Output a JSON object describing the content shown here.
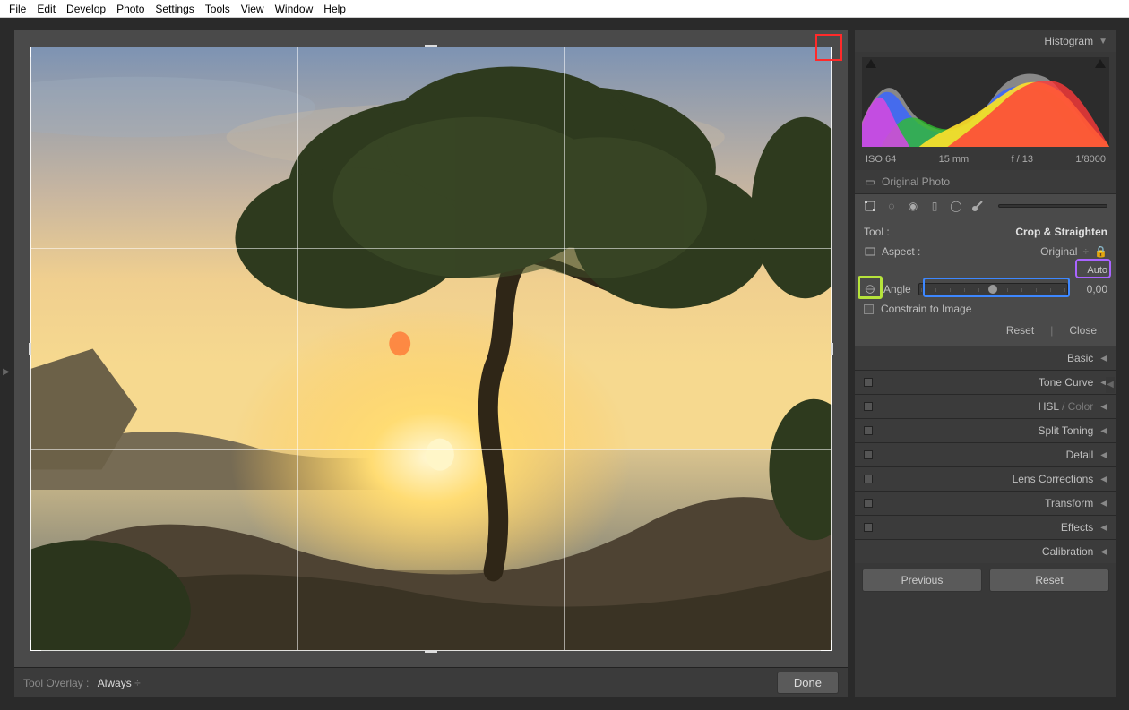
{
  "menu": [
    "File",
    "Edit",
    "Develop",
    "Photo",
    "Settings",
    "Tools",
    "View",
    "Window",
    "Help"
  ],
  "histogram_label": "Histogram",
  "meta": {
    "iso": "ISO 64",
    "focal": "15 mm",
    "aperture": "f / 13",
    "shutter": "1/8000"
  },
  "original_photo": "Original Photo",
  "tool_label": "Tool :",
  "tool_value": "Crop & Straighten",
  "aspect_label": "Aspect :",
  "aspect_value": "Original",
  "auto_label": "Auto",
  "angle_label": "Angle",
  "angle_value": "0,00",
  "constrain_label": "Constrain to Image",
  "reset_label": "Reset",
  "close_label": "Close",
  "sections": [
    "Basic",
    "Tone Curve",
    "HSL / Color",
    "Split Toning",
    "Detail",
    "Lens Corrections",
    "Transform",
    "Effects",
    "Calibration"
  ],
  "hsl_prefix": "HSL",
  "hsl_suffix": " / Color",
  "overlay_label": "Tool Overlay :",
  "overlay_value": "Always",
  "done_label": "Done",
  "previous_label": "Previous",
  "reset_btn": "Reset"
}
